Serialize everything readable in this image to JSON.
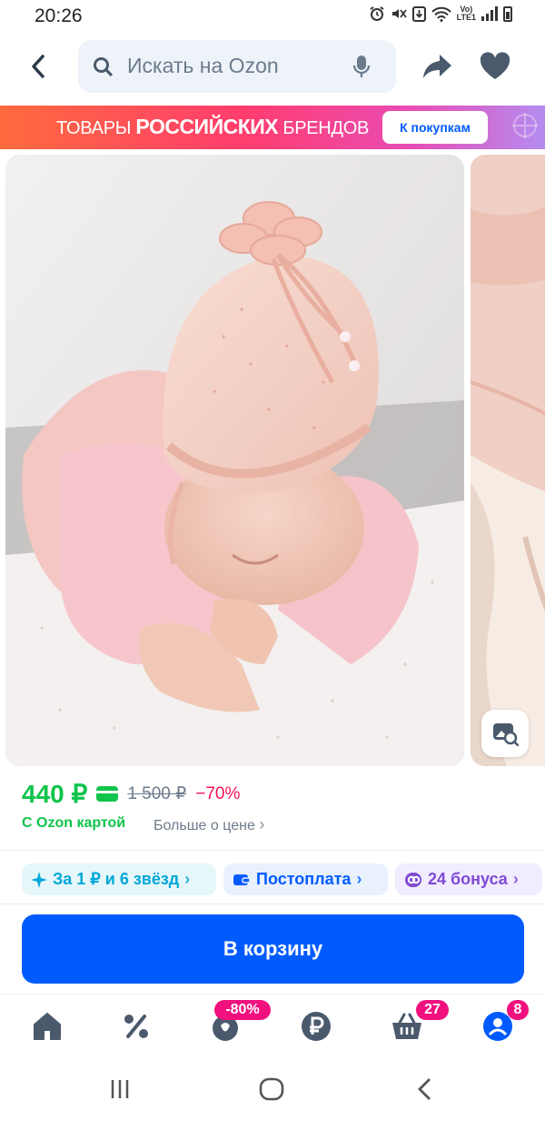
{
  "status_bar": {
    "time": "20:26",
    "network_label_top": "Vo)",
    "network_label_bottom": "LTE1"
  },
  "header": {
    "back_icon": "chevron-left-icon",
    "search_placeholder": "Искать на Ozon",
    "mic_icon": "microphone-icon",
    "share_icon": "share-icon",
    "favorite_icon": "heart-icon"
  },
  "banner": {
    "text_before": "ТОВАРЫ",
    "text_bold": "РОССИЙСКИХ",
    "text_after": "БРЕНДОВ",
    "button_label": "К покупкам",
    "colors": [
      "#ff6a3d",
      "#ff3d6e",
      "#e94cb5",
      "#b48cf0"
    ]
  },
  "gallery": {
    "photo_search_icon": "image-search-icon"
  },
  "price": {
    "current": "440 ₽",
    "old": "1 500 ₽",
    "discount": "−70%",
    "card_label": "С Ozon картой",
    "more_label": "Больше о цене",
    "green": "#10c44c",
    "red": "#f91155"
  },
  "chips": [
    {
      "label": "За 1 ₽ и 6 звёзд",
      "icon": "sparkle-icon"
    },
    {
      "label": "Постоплата",
      "icon": "wallet-icon"
    },
    {
      "label": "24 бонуса",
      "icon": "bonus-icon"
    }
  ],
  "cart": {
    "button_label": "В корзину",
    "color": "#005bff"
  },
  "bottom_nav": {
    "items": [
      {
        "icon": "home-icon"
      },
      {
        "icon": "percent-icon"
      },
      {
        "icon": "fresh-icon",
        "badge": "-80%"
      },
      {
        "icon": "ruble-icon"
      },
      {
        "icon": "basket-icon",
        "badge": "27"
      },
      {
        "icon": "profile-icon",
        "badge": "8"
      }
    ],
    "badge_color": "#f1117e"
  },
  "system_nav": {
    "recents_icon": "recents-icon",
    "home_icon": "home-circle-icon",
    "back_icon": "back-chevron-icon"
  }
}
